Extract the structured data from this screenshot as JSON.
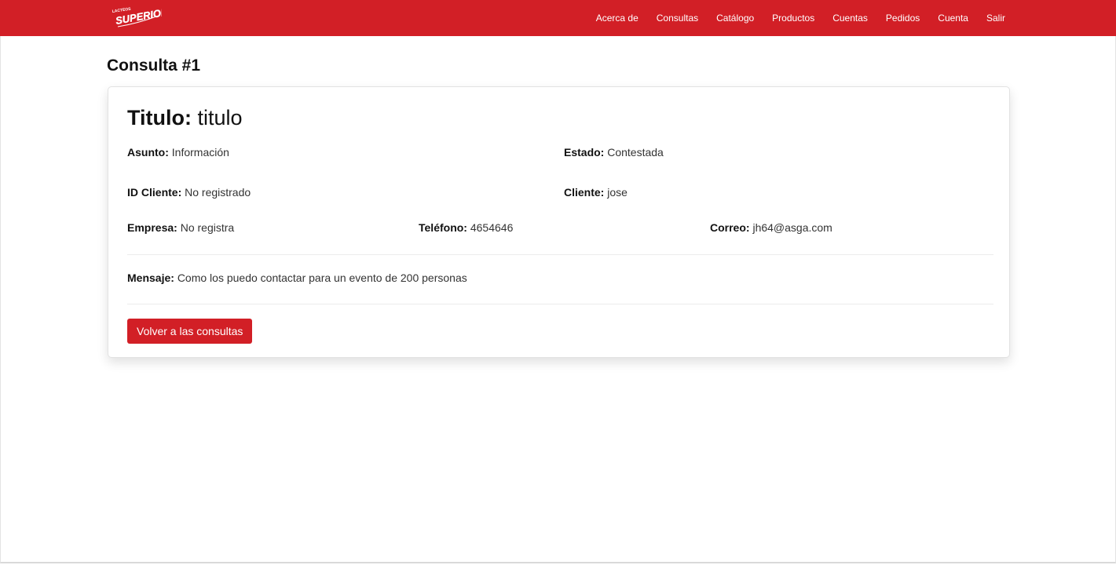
{
  "colors": {
    "brand": "#d21f26"
  },
  "brand": {
    "logo_text_small": "LACTEOS",
    "logo_text": "SUPERIOR",
    "logo_icon": "superior-logo"
  },
  "nav": {
    "items": [
      "Acerca de",
      "Consultas",
      "Catálogo",
      "Productos",
      "Cuentas",
      "Pedidos",
      "Cuenta",
      "Salir"
    ]
  },
  "page": {
    "title": "Consulta #1"
  },
  "consulta": {
    "titulo_label": "Titulo:",
    "titulo_value": "titulo",
    "asunto_label": "Asunto:",
    "asunto_value": "Información",
    "estado_label": "Estado:",
    "estado_value": "Contestada",
    "id_cliente_label": "ID Cliente:",
    "id_cliente_value": "No registrado",
    "cliente_label": "Cliente:",
    "cliente_value": "jose",
    "empresa_label": "Empresa:",
    "empresa_value": "No registra",
    "telefono_label": "Teléfono:",
    "telefono_value": "4654646",
    "correo_label": "Correo:",
    "correo_value": "jh64@asga.com",
    "mensaje_label": "Mensaje:",
    "mensaje_value": "Como los puedo contactar para un evento de 200 personas"
  },
  "actions": {
    "back_label": "Volver a las consultas"
  }
}
